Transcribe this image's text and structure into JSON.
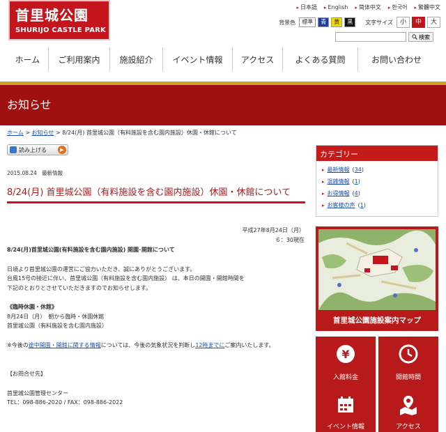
{
  "header": {
    "logo_jp": "首里城公園",
    "logo_en": "SHURIJO CASTLE PARK",
    "languages": [
      "日本語",
      "English",
      "简体中文",
      "한국어",
      "繁體中文"
    ],
    "bg_label": "背景色",
    "bg_options": [
      "標準",
      "青",
      "黄",
      "黒"
    ],
    "size_label": "文字サイズ",
    "size_options": [
      "小",
      "中",
      "大"
    ],
    "search_placeholder": "",
    "search_button": "検索"
  },
  "nav": [
    "ホーム",
    "ご利用案内",
    "施設紹介",
    "イベント情報",
    "アクセス",
    "よくある質問",
    "お問い合わせ"
  ],
  "banner_title": "お知らせ",
  "breadcrumb": {
    "home": "ホーム",
    "sep": " > ",
    "notices": "お知らせ",
    "current": "8/24(月) 首里城公園（有料施設を含む園内施設）休園・休館について"
  },
  "read_button": "読み上げる",
  "post": {
    "date": "2015.08.24",
    "category": "最新情報",
    "title": "8/24(月) 首里城公園（有料施設を含む園内施設）休園・休館について",
    "dateline1": "平成27年8月24日（月）",
    "dateline2": "６：30現在",
    "heading": "8/24(月)首里城公園(有料施設を含む園内施設) 開園･開館について",
    "p1": "日頃より首里城公園の運営にご協力いただき、誠にありがとうございます。",
    "p2": "台風15号の接近に伴い、首里城公園（有料施設を含む園内施設） は、本日の開園・開館時間を",
    "p3": "下記のとおりとさせていただきますのでお知らせします。",
    "closure_heading": "《臨時休園・休館》",
    "closure_date": "8月24日（月）　朝から臨時・休園休館",
    "closure_target": "首里城公園（有料施設を含む園内施設）",
    "note_pre": "※今後の",
    "note_link1": "途中開園・開館に関する情報",
    "note_mid": "については、今後の気象状況を判断し",
    "note_link2": "12時までに",
    "note_post": "ご案内いたします。",
    "contact_heading": "【お問合せ先】",
    "contact_org": "首里城公園管理センター",
    "contact_tel": "TEL：098-886-2020 / FAX：098-886-2022"
  },
  "sidebar": {
    "category_title": "カテゴリー",
    "categories": [
      {
        "name": "最新情報",
        "count": "34"
      },
      {
        "name": "混雑情報",
        "count": "1"
      },
      {
        "name": "お得情報",
        "count": "4"
      },
      {
        "name": "お客様の声",
        "count": "1"
      }
    ],
    "map_caption": "首里城公園施設案内マップ",
    "tiles": [
      "入館料金",
      "開館時間",
      "イベント情報",
      "アクセス"
    ]
  },
  "colors": {
    "brand_red": "#c4141c",
    "banner_red": "#a01010",
    "link_blue": "#1a4fb3"
  }
}
